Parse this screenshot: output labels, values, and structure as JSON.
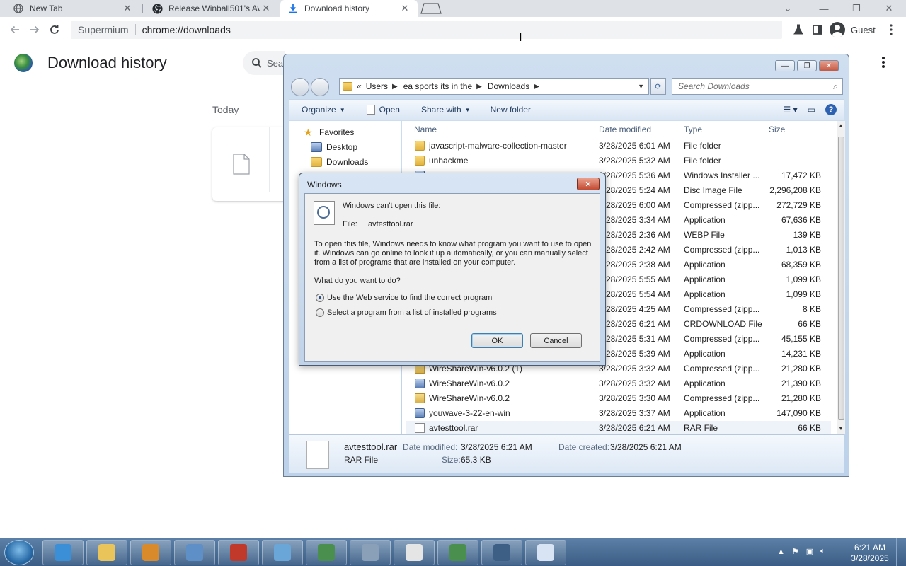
{
  "browser": {
    "tabs": [
      {
        "label": "New Tab",
        "icon": "globe-icon"
      },
      {
        "label": "Release Winball501's Av",
        "icon": "github-icon"
      },
      {
        "label": "Download history",
        "icon": "download-icon",
        "active": true
      }
    ],
    "window_controls": {
      "min": "—",
      "max": "❐",
      "close": "✕",
      "tab_search": "⌄"
    },
    "omnibox": {
      "brand": "Supermium",
      "url": "chrome://downloads"
    },
    "profile_label": "Guest"
  },
  "downloads_page": {
    "title": "Download history",
    "search_placeholder": "Sear",
    "section_label": "Today"
  },
  "explorer": {
    "breadcrumb": [
      "«",
      "Users",
      "ea sports its in the",
      "Downloads"
    ],
    "search_placeholder": "Search Downloads",
    "toolbar": {
      "organize": "Organize",
      "open": "Open",
      "share_with": "Share with",
      "new_folder": "New folder"
    },
    "nav": {
      "favorites": "Favorites",
      "desktop": "Desktop",
      "downloads": "Downloads"
    },
    "columns": {
      "name": "Name",
      "date": "Date modified",
      "type": "Type",
      "size": "Size"
    },
    "files": [
      {
        "name": "javascript-malware-collection-master",
        "date": "3/28/2025 6:01 AM",
        "type": "File folder",
        "size": "",
        "icon": "folder"
      },
      {
        "name": "unhackme",
        "date": "3/28/2025 5:32 AM",
        "type": "File folder",
        "size": "",
        "icon": "folder"
      },
      {
        "name": "",
        "date": "3/28/2025 5:36 AM",
        "type": "Windows Installer ...",
        "size": "17,472 KB",
        "icon": "app"
      },
      {
        "name": "",
        "date": "3/28/2025 5:24 AM",
        "type": "Disc Image File",
        "size": "2,296,208 KB",
        "icon": "doc"
      },
      {
        "name": "",
        "date": "3/28/2025 6:00 AM",
        "type": "Compressed (zipp...",
        "size": "272,729 KB",
        "icon": "zip"
      },
      {
        "name": "",
        "date": "3/28/2025 3:34 AM",
        "type": "Application",
        "size": "67,636 KB",
        "icon": "app"
      },
      {
        "name": "",
        "date": "3/28/2025 2:36 AM",
        "type": "WEBP File",
        "size": "139 KB",
        "icon": "doc"
      },
      {
        "name": "",
        "date": "3/28/2025 2:42 AM",
        "type": "Compressed (zipp...",
        "size": "1,013 KB",
        "icon": "zip"
      },
      {
        "name": "",
        "date": "3/28/2025 2:38 AM",
        "type": "Application",
        "size": "68,359 KB",
        "icon": "app"
      },
      {
        "name": "",
        "date": "3/28/2025 5:55 AM",
        "type": "Application",
        "size": "1,099 KB",
        "icon": "app"
      },
      {
        "name": "",
        "date": "3/28/2025 5:54 AM",
        "type": "Application",
        "size": "1,099 KB",
        "icon": "app"
      },
      {
        "name": "",
        "date": "3/28/2025 4:25 AM",
        "type": "Compressed (zipp...",
        "size": "8 KB",
        "icon": "zip"
      },
      {
        "name": "",
        "date": "3/28/2025 6:21 AM",
        "type": "CRDOWNLOAD File",
        "size": "66 KB",
        "icon": "doc"
      },
      {
        "name": "",
        "date": "3/28/2025 5:31 AM",
        "type": "Compressed (zipp...",
        "size": "45,155 KB",
        "icon": "zip"
      },
      {
        "name": "",
        "date": "3/28/2025 5:39 AM",
        "type": "Application",
        "size": "14,231 KB",
        "icon": "app"
      },
      {
        "name": "WireShareWin-v6.0.2 (1)",
        "date": "3/28/2025 3:32 AM",
        "type": "Compressed (zipp...",
        "size": "21,280 KB",
        "icon": "zip"
      },
      {
        "name": "WireShareWin-v6.0.2",
        "date": "3/28/2025 3:32 AM",
        "type": "Application",
        "size": "21,390 KB",
        "icon": "app"
      },
      {
        "name": "WireShareWin-v6.0.2",
        "date": "3/28/2025 3:30 AM",
        "type": "Compressed (zipp...",
        "size": "21,280 KB",
        "icon": "zip"
      },
      {
        "name": "youwave-3-22-en-win",
        "date": "3/28/2025 3:37 AM",
        "type": "Application",
        "size": "147,090 KB",
        "icon": "app"
      },
      {
        "name": "avtesttool.rar",
        "date": "3/28/2025 6:21 AM",
        "type": "RAR File",
        "size": "66 KB",
        "icon": "doc",
        "selected": true
      }
    ],
    "details": {
      "name": "avtesttool.rar",
      "type": "RAR File",
      "date_modified_label": "Date modified:",
      "date_modified": "3/28/2025 6:21 AM",
      "date_created_label": "Date created:",
      "date_created": "3/28/2025 6:21 AM",
      "size_label": "Size:",
      "size": "65.3 KB"
    }
  },
  "dialog": {
    "title": "Windows",
    "heading": "Windows can't open this file:",
    "file_label": "File:",
    "file_name": "avtesttool.rar",
    "paragraph": "To open this file, Windows needs to know what program you want to use to open it. Windows can go online to look it up automatically, or you can manually select from a list of programs that are installed on your computer.",
    "question": "What do you want to do?",
    "option_web": "Use the Web service to find the correct program",
    "option_list": "Select a program from a list of installed programs",
    "ok": "OK",
    "cancel": "Cancel"
  },
  "taskbar": {
    "clock_time": "6:21 AM",
    "clock_date": "3/28/2025",
    "apps": [
      "ie-icon",
      "explorer-icon",
      "media-player-icon",
      "computer-icon",
      "toolbox-icon",
      "control-panel-icon",
      "browser-icon",
      "device-icon",
      "notepad-icon",
      "browser-icon",
      "spy-icon",
      "document-icon"
    ]
  }
}
